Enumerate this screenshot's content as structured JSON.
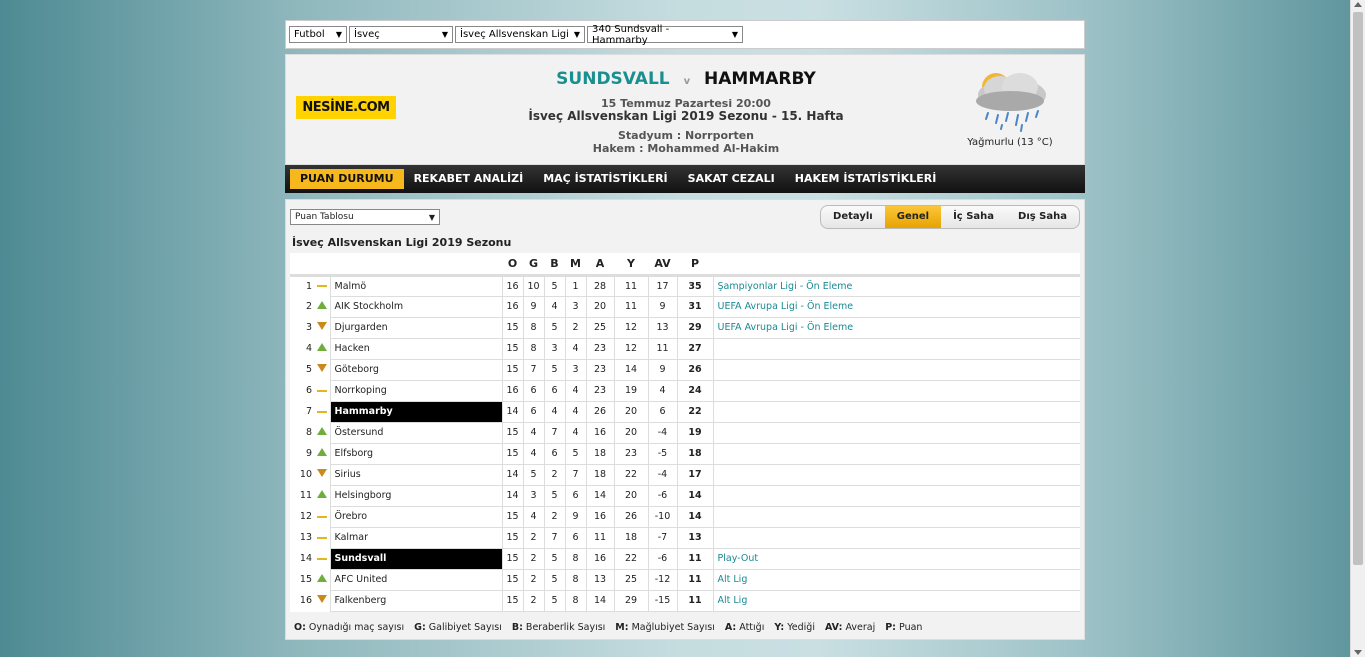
{
  "selectors": {
    "sport": "Futbol",
    "country": "İsveç",
    "league": "İsveç Allsvenskan Ligi",
    "match": "340 Sundsvall - Hammarby"
  },
  "brand": {
    "logo_text": "NESİNE.COM"
  },
  "match": {
    "home": "SUNDSVALL",
    "vs": "v",
    "away": "HAMMARBY",
    "date": "15 Temmuz Pazartesi 20:00",
    "season": "İsveç Allsvenskan Ligi 2019 Sezonu - 15. Hafta",
    "stadium": "Stadyum : Norrporten",
    "referee": "Hakem : Mohammed Al-Hakim"
  },
  "weather": {
    "icon": "rain-cloud-icon",
    "label": "Yağmurlu (13 °C)"
  },
  "tabs": [
    {
      "label": "PUAN DURUMU",
      "active": true
    },
    {
      "label": "REKABET ANALİZİ",
      "active": false
    },
    {
      "label": "MAÇ İSTATİSTİKLERİ",
      "active": false
    },
    {
      "label": "SAKAT CEZALI",
      "active": false
    },
    {
      "label": "HAKEM İSTATİSTİKLERİ",
      "active": false
    }
  ],
  "table_select": "Puan Tablosu",
  "segments": [
    {
      "label": "Detaylı",
      "active": false
    },
    {
      "label": "Genel",
      "active": true
    },
    {
      "label": "İç Saha",
      "active": false
    },
    {
      "label": "Dış Saha",
      "active": false
    }
  ],
  "season_title": "İsveç Allsvenskan Ligi 2019 Sezonu",
  "columns": [
    "O",
    "G",
    "B",
    "M",
    "A",
    "Y",
    "AV",
    "P"
  ],
  "rows": [
    {
      "rank": "1",
      "trend": "same",
      "team": "Malmö",
      "o": "16",
      "g": "10",
      "b": "5",
      "m": "1",
      "a": "28",
      "y": "11",
      "av": "17",
      "p": "35",
      "note": "Şampiyonlar Ligi - Ön Eleme",
      "hl": false
    },
    {
      "rank": "2",
      "trend": "up",
      "team": "AIK Stockholm",
      "o": "16",
      "g": "9",
      "b": "4",
      "m": "3",
      "a": "20",
      "y": "11",
      "av": "9",
      "p": "31",
      "note": "UEFA Avrupa Ligi - Ön Eleme",
      "hl": false
    },
    {
      "rank": "3",
      "trend": "down",
      "team": "Djurgarden",
      "o": "15",
      "g": "8",
      "b": "5",
      "m": "2",
      "a": "25",
      "y": "12",
      "av": "13",
      "p": "29",
      "note": "UEFA Avrupa Ligi - Ön Eleme",
      "hl": false
    },
    {
      "rank": "4",
      "trend": "up",
      "team": "Hacken",
      "o": "15",
      "g": "8",
      "b": "3",
      "m": "4",
      "a": "23",
      "y": "12",
      "av": "11",
      "p": "27",
      "note": "",
      "hl": false
    },
    {
      "rank": "5",
      "trend": "down",
      "team": "Göteborg",
      "o": "15",
      "g": "7",
      "b": "5",
      "m": "3",
      "a": "23",
      "y": "14",
      "av": "9",
      "p": "26",
      "note": "",
      "hl": false
    },
    {
      "rank": "6",
      "trend": "same",
      "team": "Norrkoping",
      "o": "16",
      "g": "6",
      "b": "6",
      "m": "4",
      "a": "23",
      "y": "19",
      "av": "4",
      "p": "24",
      "note": "",
      "hl": false
    },
    {
      "rank": "7",
      "trend": "same",
      "team": "Hammarby",
      "o": "14",
      "g": "6",
      "b": "4",
      "m": "4",
      "a": "26",
      "y": "20",
      "av": "6",
      "p": "22",
      "note": "",
      "hl": true
    },
    {
      "rank": "8",
      "trend": "up",
      "team": "Östersund",
      "o": "15",
      "g": "4",
      "b": "7",
      "m": "4",
      "a": "16",
      "y": "20",
      "av": "-4",
      "p": "19",
      "note": "",
      "hl": false
    },
    {
      "rank": "9",
      "trend": "up",
      "team": "Elfsborg",
      "o": "15",
      "g": "4",
      "b": "6",
      "m": "5",
      "a": "18",
      "y": "23",
      "av": "-5",
      "p": "18",
      "note": "",
      "hl": false
    },
    {
      "rank": "10",
      "trend": "down",
      "team": "Sirius",
      "o": "14",
      "g": "5",
      "b": "2",
      "m": "7",
      "a": "18",
      "y": "22",
      "av": "-4",
      "p": "17",
      "note": "",
      "hl": false
    },
    {
      "rank": "11",
      "trend": "up",
      "team": "Helsingborg",
      "o": "14",
      "g": "3",
      "b": "5",
      "m": "6",
      "a": "14",
      "y": "20",
      "av": "-6",
      "p": "14",
      "note": "",
      "hl": false
    },
    {
      "rank": "12",
      "trend": "same",
      "team": "Örebro",
      "o": "15",
      "g": "4",
      "b": "2",
      "m": "9",
      "a": "16",
      "y": "26",
      "av": "-10",
      "p": "14",
      "note": "",
      "hl": false
    },
    {
      "rank": "13",
      "trend": "same",
      "team": "Kalmar",
      "o": "15",
      "g": "2",
      "b": "7",
      "m": "6",
      "a": "11",
      "y": "18",
      "av": "-7",
      "p": "13",
      "note": "",
      "hl": false
    },
    {
      "rank": "14",
      "trend": "same",
      "team": "Sundsvall",
      "o": "15",
      "g": "2",
      "b": "5",
      "m": "8",
      "a": "16",
      "y": "22",
      "av": "-6",
      "p": "11",
      "note": "Play-Out",
      "hl": true
    },
    {
      "rank": "15",
      "trend": "up",
      "team": "AFC United",
      "o": "15",
      "g": "2",
      "b": "5",
      "m": "8",
      "a": "13",
      "y": "25",
      "av": "-12",
      "p": "11",
      "note": "Alt Lig",
      "hl": false
    },
    {
      "rank": "16",
      "trend": "down",
      "team": "Falkenberg",
      "o": "15",
      "g": "2",
      "b": "5",
      "m": "8",
      "a": "14",
      "y": "29",
      "av": "-15",
      "p": "11",
      "note": "Alt Lig",
      "hl": false
    }
  ],
  "legend": [
    {
      "key": "O:",
      "text": "Oynadığı maç sayısı"
    },
    {
      "key": "G:",
      "text": "Galibiyet Sayısı"
    },
    {
      "key": "B:",
      "text": "Beraberlik Sayısı"
    },
    {
      "key": "M:",
      "text": "Mağlubiyet Sayısı"
    },
    {
      "key": "A:",
      "text": "Attığı"
    },
    {
      "key": "Y:",
      "text": "Yediği"
    },
    {
      "key": "AV:",
      "text": "Averaj"
    },
    {
      "key": "P:",
      "text": "Puan"
    }
  ],
  "colors": {
    "accent": "#f7b81d",
    "home": "#1a8f8f",
    "up": "#6fae3b",
    "down": "#c98a1b"
  }
}
